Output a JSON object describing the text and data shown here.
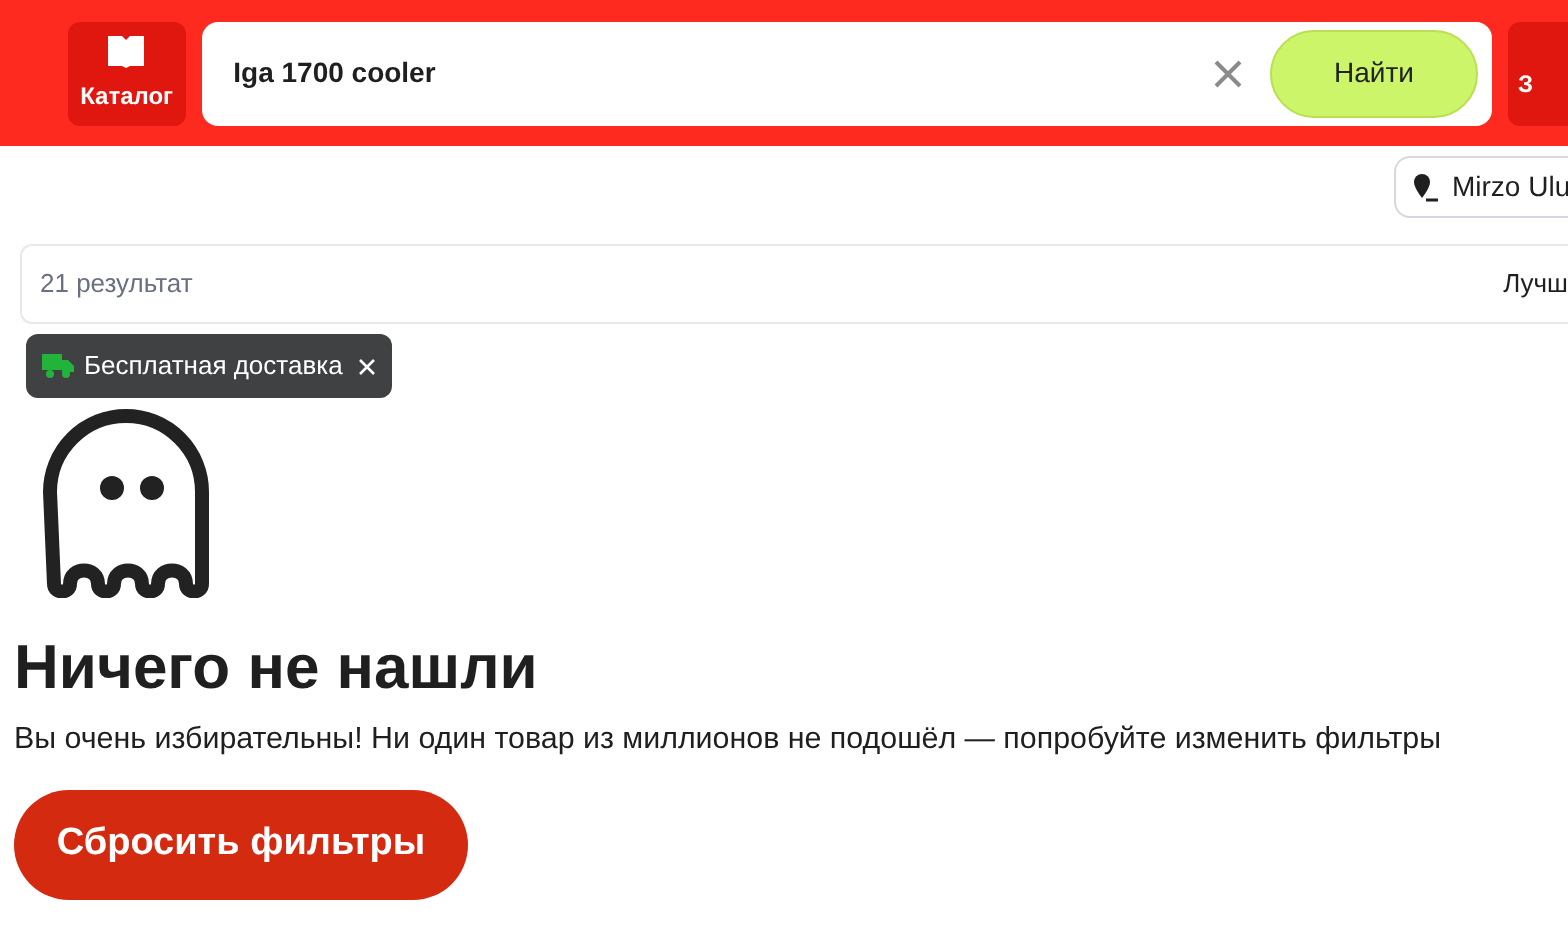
{
  "header": {
    "catalog_button": "Каталог",
    "search": {
      "value": "Iga 1700 cooler"
    },
    "search_button": "Найти",
    "right_button": "З"
  },
  "location": "Mirzo Ulu",
  "results_bar": {
    "count": "21 результат",
    "sort": "Лучш"
  },
  "filters": [
    {
      "label": "Бесплатная доставка"
    }
  ],
  "empty_state": {
    "title": "Ничего не нашли",
    "message": "Вы очень избирательны! Ни один товар из миллионов не подошёл — попробуйте изменить фильтры",
    "button": "Сбросить фильтры"
  }
}
